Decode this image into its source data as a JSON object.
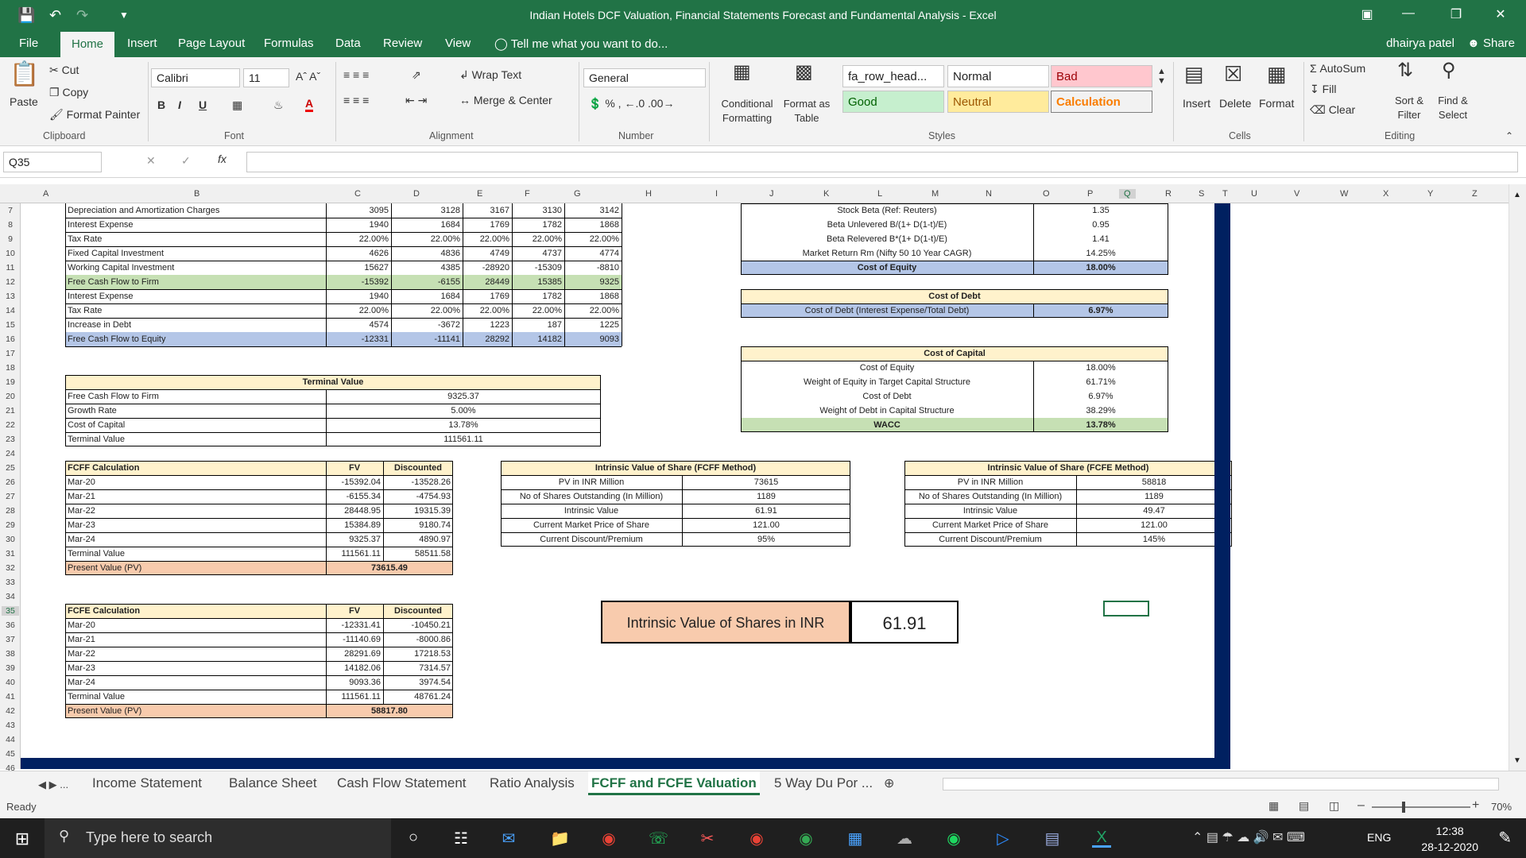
{
  "window": {
    "title": "Indian Hotels DCF Valuation, Financial Statements Forecast and Fundamental Analysis - Excel"
  },
  "ribbon_tabs": [
    "File",
    "Home",
    "Insert",
    "Page Layout",
    "Formulas",
    "Data",
    "Review",
    "View"
  ],
  "tell_me": "Tell me what you want to do...",
  "user": "dhairya patel",
  "share": "Share",
  "clipboard": {
    "paste": "Paste",
    "cut": "Cut",
    "copy": "Copy",
    "format_painter": "Format Painter",
    "label": "Clipboard"
  },
  "font": {
    "name": "Calibri",
    "size": "11",
    "label": "Font"
  },
  "alignment": {
    "wrap": "Wrap Text",
    "merge": "Merge & Center",
    "label": "Alignment"
  },
  "number": {
    "format": "General",
    "label": "Number"
  },
  "styles": {
    "cond": "Conditional Formatting",
    "table": "Format as Table",
    "s1": "fa_row_head...",
    "s2": "Normal",
    "s3": "Bad",
    "s4": "Good",
    "s5": "Neutral",
    "s6": "Calculation",
    "label": "Styles"
  },
  "cells": {
    "insert": "Insert",
    "delete": "Delete",
    "format": "Format",
    "label": "Cells"
  },
  "editing": {
    "autosum": "AutoSum",
    "fill": "Fill",
    "clear": "Clear",
    "sort": "Sort & Filter",
    "find": "Find & Select",
    "label": "Editing"
  },
  "namebox": "Q35",
  "columns": [
    "A",
    "B",
    "C",
    "D",
    "E",
    "F",
    "G",
    "H",
    "I",
    "J",
    "K",
    "L",
    "M",
    "N",
    "O",
    "P",
    "Q",
    "R",
    "S",
    "T",
    "U",
    "V",
    "W",
    "X",
    "Y",
    "Z"
  ],
  "rows": [
    "7",
    "8",
    "9",
    "10",
    "11",
    "12",
    "13",
    "14",
    "15",
    "16",
    "17",
    "18",
    "19",
    "20",
    "21",
    "22",
    "23",
    "24",
    "25",
    "26",
    "27",
    "28",
    "29",
    "30",
    "31",
    "32",
    "33",
    "34",
    "35",
    "36",
    "37",
    "38",
    "39",
    "40",
    "41",
    "42",
    "43",
    "44",
    "45",
    "46"
  ],
  "forecast": [
    [
      "Depreciation and Amortization Charges",
      "3095",
      "3128",
      "3167",
      "3130",
      "3142"
    ],
    [
      "Interest Expense",
      "1940",
      "1684",
      "1769",
      "1782",
      "1868"
    ],
    [
      "Tax Rate",
      "22.00%",
      "22.00%",
      "22.00%",
      "22.00%",
      "22.00%"
    ],
    [
      "Fixed Capital Investment",
      "4626",
      "4836",
      "4749",
      "4737",
      "4774"
    ],
    [
      "Working Capital Investment",
      "15627",
      "4385",
      "-28920",
      "-15309",
      "-8810"
    ],
    [
      "Free Cash Flow to Firm",
      "-15392",
      "-6155",
      "28449",
      "15385",
      "9325"
    ],
    [
      "Interest Expense",
      "1940",
      "1684",
      "1769",
      "1782",
      "1868"
    ],
    [
      "Tax Rate",
      "22.00%",
      "22.00%",
      "22.00%",
      "22.00%",
      "22.00%"
    ],
    [
      "Increase in Debt",
      "4574",
      "-3672",
      "1223",
      "187",
      "1225"
    ],
    [
      "Free Cash Flow to Equity",
      "-12331",
      "-11141",
      "28292",
      "14182",
      "9093"
    ]
  ],
  "equity": [
    [
      "Stock Beta (Ref: Reuters)",
      "1.35"
    ],
    [
      "Beta Unlevered B/(1+ D(1-t)/E)",
      "0.95"
    ],
    [
      "Beta Relevered B*(1+ D(1-t)/E)",
      "1.41"
    ],
    [
      "Market Return Rm (Nifty 50 10 Year CAGR)",
      "14.25%"
    ],
    [
      "Cost of Equity",
      "18.00%"
    ]
  ],
  "debt": {
    "title": "Cost of Debt",
    "label": "Cost of Debt (Interest Expense/Total Debt)",
    "value": "6.97%"
  },
  "capital": {
    "title": "Cost of Capital",
    "rows": [
      [
        "Cost of Equity",
        "18.00%"
      ],
      [
        "Weight of Equity in Target Capital Structure",
        "61.71%"
      ],
      [
        "Cost of Debt",
        "6.97%"
      ],
      [
        "Weight of Debt in Capital Structure",
        "38.29%"
      ],
      [
        "WACC",
        "13.78%"
      ]
    ]
  },
  "terminal": {
    "title": "Terminal Value",
    "rows": [
      [
        "Free Cash Flow to Firm",
        "9325.37"
      ],
      [
        "Growth Rate",
        "5.00%"
      ],
      [
        "Cost of Capital",
        "13.78%"
      ],
      [
        "Terminal Value",
        "111561.11"
      ]
    ]
  },
  "fcff": {
    "h": [
      "FCFF Calculation",
      "FV",
      "Discounted"
    ],
    "rows": [
      [
        "Mar-20",
        "-15392.04",
        "-13528.26"
      ],
      [
        "Mar-21",
        "-6155.34",
        "-4754.93"
      ],
      [
        "Mar-22",
        "28448.95",
        "19315.39"
      ],
      [
        "Mar-23",
        "15384.89",
        "9180.74"
      ],
      [
        "Mar-24",
        "9325.37",
        "4890.97"
      ],
      [
        "Terminal Value",
        "111561.11",
        "58511.58"
      ]
    ],
    "pv_label": "Present Value (PV)",
    "pv": "73615.49"
  },
  "fcfe": {
    "h": [
      "FCFE Calculation",
      "FV",
      "Discounted"
    ],
    "rows": [
      [
        "Mar-20",
        "-12331.41",
        "-10450.21"
      ],
      [
        "Mar-21",
        "-11140.69",
        "-8000.86"
      ],
      [
        "Mar-22",
        "28291.69",
        "17218.53"
      ],
      [
        "Mar-23",
        "14182.06",
        "7314.57"
      ],
      [
        "Mar-24",
        "9093.36",
        "3974.54"
      ],
      [
        "Terminal Value",
        "111561.11",
        "48761.24"
      ]
    ],
    "pv_label": "Present Value (PV)",
    "pv": "58817.80"
  },
  "iv1": {
    "title": "Intrinsic Value of Share (FCFF Method)",
    "rows": [
      [
        "PV in INR Million",
        "73615"
      ],
      [
        "No of Shares Outstanding (In Million)",
        "1189"
      ],
      [
        "Intrinsic Value",
        "61.91"
      ],
      [
        "Current Market Price of Share",
        "121.00"
      ],
      [
        "Current Discount/Premium",
        "95%"
      ]
    ]
  },
  "iv2": {
    "title": "Intrinsic Value of Share (FCFE Method)",
    "rows": [
      [
        "PV in INR Million",
        "58818"
      ],
      [
        "No of Shares Outstanding (In Million)",
        "1189"
      ],
      [
        "Intrinsic Value",
        "49.47"
      ],
      [
        "Current Market Price of Share",
        "121.00"
      ],
      [
        "Current Discount/Premium",
        "145%"
      ]
    ]
  },
  "big": {
    "label": "Intrinsic Value of Shares in INR",
    "value": "61.91"
  },
  "sheets": [
    "Income Statement",
    "Balance Sheet",
    "Cash Flow Statement",
    "Ratio Analysis",
    "FCFF and FCFE Valuation",
    "5 Way Du Por ..."
  ],
  "status": "Ready",
  "zoom": "70%",
  "taskbar": {
    "search": "Type here to search",
    "lang": "ENG",
    "time": "12:38",
    "date": "28-12-2020"
  },
  "colors": {
    "excel_green": "#217346",
    "header_yellow": "#fff2cc",
    "highlight_green": "#c6e0b4",
    "highlight_blue": "#b4c6e7",
    "peach": "#f8cbad"
  }
}
